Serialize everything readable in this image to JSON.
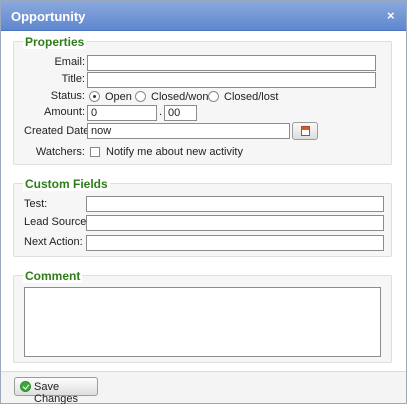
{
  "dialog": {
    "title": "Opportunity",
    "close_glyph": "×"
  },
  "properties": {
    "title": "Properties",
    "email_label": "Email:",
    "email_value": "",
    "title_label": "Title:",
    "title_value": "",
    "status_label": "Status:",
    "status_options": [
      "Open",
      "Closed/won",
      "Closed/lost"
    ],
    "status_selected": "Open",
    "amount_label": "Amount:",
    "amount_whole": "0",
    "amount_sep": ".",
    "amount_cents": "00",
    "created_date_label": "Created Date:",
    "created_date_value": "now",
    "watchers_label": "Watchers:",
    "watchers_checkbox_label": "Notify me about new activity",
    "watchers_checked": false
  },
  "custom_fields": {
    "title": "Custom Fields",
    "test_label": "Test:",
    "test_value": "",
    "lead_source_label": "Lead Source:",
    "lead_source_value": "",
    "next_action_label": "Next Action:",
    "next_action_value": ""
  },
  "comment": {
    "title": "Comment",
    "value": ""
  },
  "footer": {
    "save_label": "Save Changes"
  },
  "icons": {
    "calendar": "calendar-icon",
    "save": "checkmark-icon",
    "close": "close-icon"
  },
  "colors": {
    "titlebar": "#6f93d6",
    "section_title": "#2e7d1a",
    "save_icon": "#3ca83c"
  }
}
